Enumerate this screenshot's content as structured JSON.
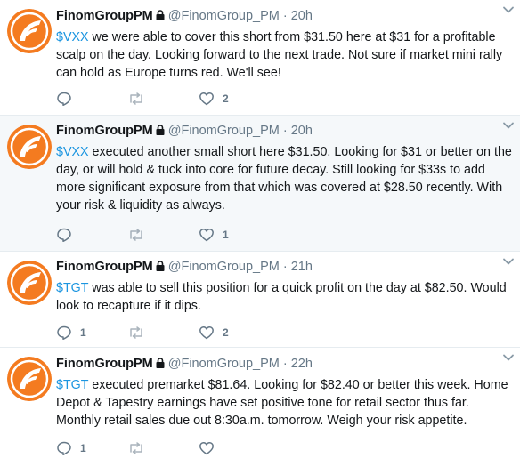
{
  "colors": {
    "link": "#1b95e0",
    "muted": "#657786",
    "avatar_bg": "#f47b20",
    "highlight_bg": "#f5f8fa"
  },
  "icons": {
    "reply": "reply-icon",
    "retweet": "retweet-icon",
    "like": "heart-icon",
    "more": "chevron-down-icon",
    "protected": "lock-icon"
  },
  "tweets": [
    {
      "name": "FinomGroupPM",
      "handle": "@FinomGroup_PM",
      "time": "20h",
      "cashtag": "$VXX",
      "body": " we were able to cover this short from $31.50 here at $31 for a profitable scalp on the day. Looking forward to the next trade. Not sure if market mini rally can hold as Europe turns red. We'll see!",
      "replies": "",
      "retweets": "",
      "likes": "2"
    },
    {
      "name": "FinomGroupPM",
      "handle": "@FinomGroup_PM",
      "time": "20h",
      "cashtag": "$VXX",
      "body": " executed another small short here $31.50. Looking for $31 or better on the day, or will hold & tuck into core for future decay. Still looking for $33s to add more significant exposure from that which was covered at $28.50 recently. With your risk & liquidity as always.",
      "replies": "",
      "retweets": "",
      "likes": "1"
    },
    {
      "name": "FinomGroupPM",
      "handle": "@FinomGroup_PM",
      "time": "21h",
      "cashtag": "$TGT",
      "body": " was able to sell this position for a quick profit on the day at $82.50. Would look to recapture if it dips.",
      "replies": "1",
      "retweets": "",
      "likes": "2"
    },
    {
      "name": "FinomGroupPM",
      "handle": "@FinomGroup_PM",
      "time": "22h",
      "cashtag": "$TGT",
      "body": " executed premarket $81.64. Looking for $82.40 or better this week. Home Depot & Tapestry earnings have set positive tone for retail sector thus far. Monthly retail sales due out 8:30a.m. tomorrow. Weigh your risk appetite.",
      "replies": "1",
      "retweets": "",
      "likes": ""
    }
  ]
}
